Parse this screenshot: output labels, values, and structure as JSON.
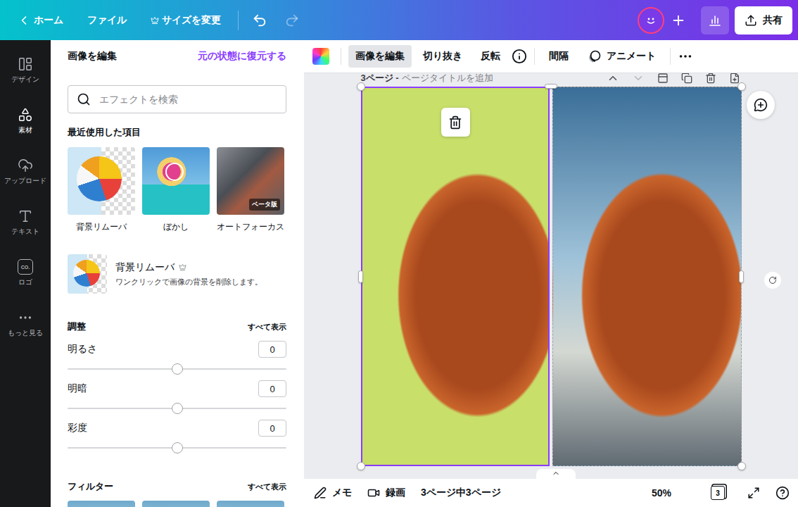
{
  "top_bar": {
    "home": "ホーム",
    "menus": [
      {
        "label": "ファイル",
        "premium": false
      },
      {
        "label": "サイズを変更",
        "premium": true
      }
    ],
    "undo": {
      "disabled": false
    },
    "redo": {
      "disabled": true
    },
    "share": "共有"
  },
  "sidebar": {
    "logo_mark": "CO.",
    "items": [
      {
        "label": "デザイン",
        "kind": "design",
        "selected": false
      },
      {
        "label": "素材",
        "kind": "elements",
        "selected": true
      },
      {
        "label": "アップロード",
        "kind": "uploads",
        "selected": false
      },
      {
        "label": "テキスト",
        "kind": "text",
        "selected": false
      },
      {
        "label": "ロゴ",
        "kind": "logo",
        "selected": false
      },
      {
        "label": "もっと見る",
        "kind": "more",
        "selected": false
      }
    ]
  },
  "panel": {
    "title": "画像を編集",
    "reset": "元の状態に復元する",
    "search": {
      "placeholder": "エフェクトを検索"
    },
    "recent": {
      "title": "最近使用した項目",
      "items": [
        {
          "label": "背景リムーバ",
          "kind": "remover"
        },
        {
          "label": "ぼかし",
          "kind": "blur"
        },
        {
          "label": "オートフォーカス",
          "kind": "focus",
          "badge": "ベータ版"
        }
      ]
    },
    "feature": {
      "title": "背景リムーバ",
      "premium": true,
      "description": "ワンクリックで画像の背景を削除します。"
    },
    "adjust": {
      "title": "調整",
      "show_all": "すべて表示",
      "sliders": [
        {
          "label": "明るさ",
          "value": "0",
          "level": 0.5
        },
        {
          "label": "明暗",
          "value": "0",
          "level": 0.5
        },
        {
          "label": "彩度",
          "value": "0",
          "level": 0.5
        }
      ]
    },
    "filters": {
      "title": "フィルター",
      "show_all": "すべて表示"
    }
  },
  "toolbar": {
    "items": [
      {
        "label": "画像を編集",
        "selected": true
      },
      {
        "label": "切り抜き",
        "selected": false
      },
      {
        "label": "反転",
        "selected": false
      }
    ],
    "spacing": "間隔",
    "animate": "アニメート"
  },
  "page": {
    "title": "3ページ -",
    "title_placeholder": "ページタイトルを追加",
    "move_up_disabled": false,
    "move_down_disabled": true,
    "images": [
      {
        "selected": true
      },
      {
        "selected": false
      }
    ]
  },
  "bottom_bar": {
    "notes": "メモ",
    "record": "録画",
    "pages": "3ページ中3ページ",
    "zoom": "50%",
    "page_count": "3"
  }
}
